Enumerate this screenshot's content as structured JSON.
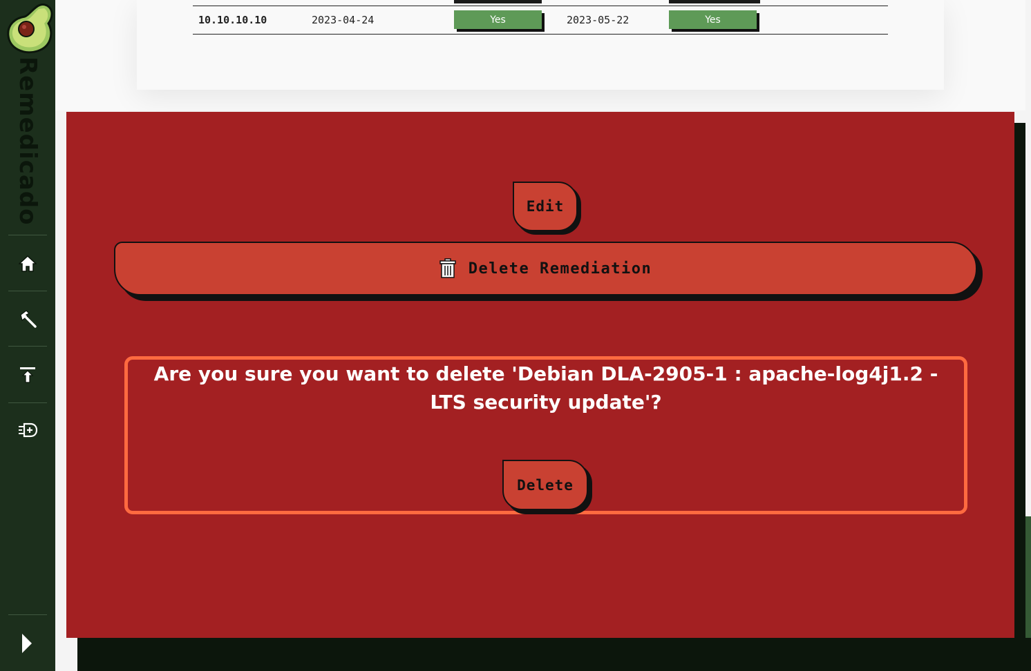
{
  "app": {
    "brand": "Remedicado"
  },
  "sidebar": {
    "items": [
      {
        "icon": "home-icon"
      },
      {
        "icon": "hammer-icon"
      },
      {
        "icon": "upload-icon"
      },
      {
        "icon": "add-list-icon"
      }
    ],
    "expand_icon": "chevron-right-icon"
  },
  "table": {
    "row": {
      "ip": "10.10.10.10",
      "date1": "2023-04-24",
      "status1": "Yes",
      "date2": "2023-05-22",
      "status2": "Yes"
    }
  },
  "panel": {
    "edit_label": "Edit",
    "delete_remediation_label": "Delete Remediation",
    "confirm_text": "Are you sure you want to delete 'Debian DLA-2905-1 : apache-log4j1.2 - LTS security update'?",
    "delete_label": "Delete"
  },
  "colors": {
    "sidebar": "#1c2f1c",
    "panel_red": "#a32022",
    "button_red": "#c94132",
    "confirm_border": "#ff6a40",
    "badge_green": "#5e9a57"
  }
}
